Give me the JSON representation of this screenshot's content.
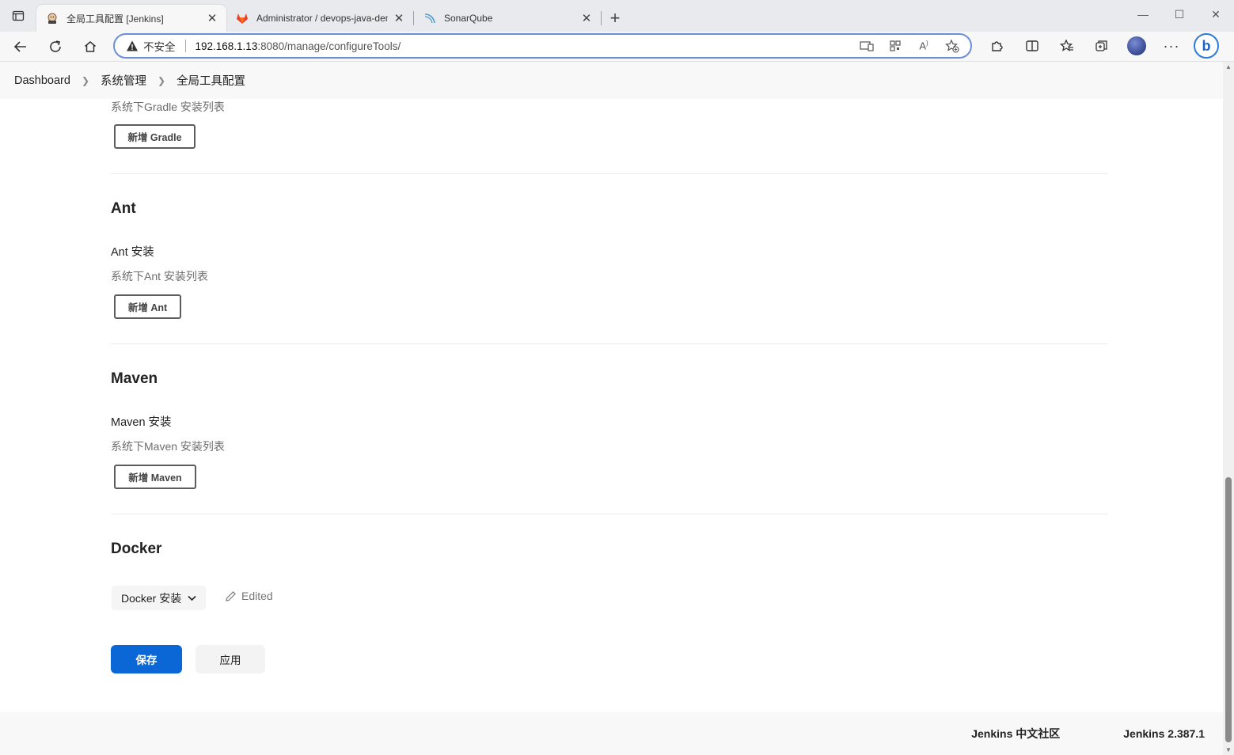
{
  "browser": {
    "tabs": [
      {
        "title": "全局工具配置 [Jenkins]",
        "favicon": "jenkins-icon",
        "active": true
      },
      {
        "title": "Administrator / devops-java-demo",
        "favicon": "gitlab-icon",
        "active": false
      },
      {
        "title": "SonarQube",
        "favicon": "sonarqube-icon",
        "active": false
      }
    ],
    "address": {
      "security_label": "不安全",
      "host": "192.168.1.13",
      "path": ":8080/manage/configureTools/"
    }
  },
  "breadcrumb": {
    "items": [
      "Dashboard",
      "系统管理",
      "全局工具配置"
    ]
  },
  "sections": {
    "gradle": {
      "hint": "系统下Gradle 安装列表",
      "add_button": "新增 Gradle"
    },
    "ant": {
      "title": "Ant",
      "install_label": "Ant 安装",
      "hint": "系统下Ant 安装列表",
      "add_button": "新增 Ant"
    },
    "maven": {
      "title": "Maven",
      "install_label": "Maven 安装",
      "hint": "系统下Maven 安装列表",
      "add_button": "新增 Maven"
    },
    "docker": {
      "title": "Docker",
      "dropdown_label": "Docker 安装",
      "status": "Edited"
    }
  },
  "actions": {
    "save": "保存",
    "apply": "应用"
  },
  "footer": {
    "community": "Jenkins 中文社区",
    "version": "Jenkins 2.387.1"
  },
  "colors": {
    "primary": "#0b66d6",
    "address_border": "#6a8fd6"
  }
}
